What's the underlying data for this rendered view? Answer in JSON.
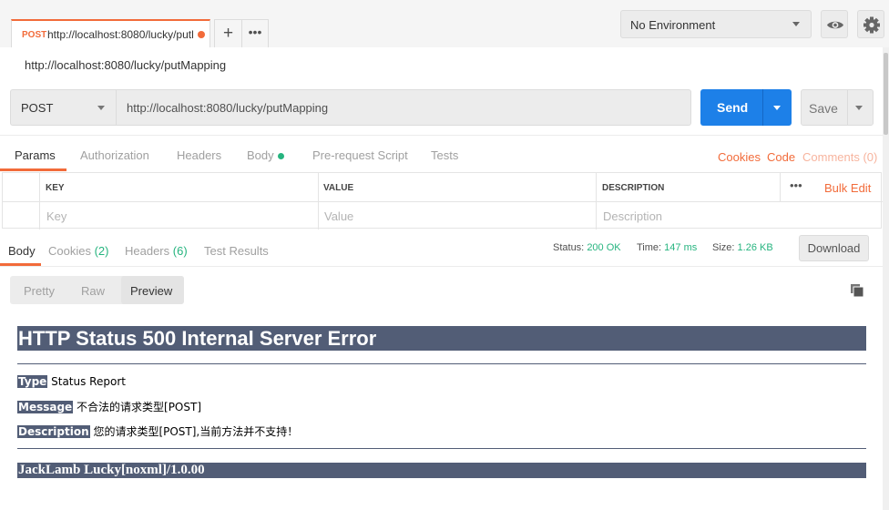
{
  "tab": {
    "method": "POST",
    "title": "http://localhost:8080/lucky/putl",
    "new_tab_label": "+",
    "more_label": "•••"
  },
  "environment": {
    "selected": "No Environment"
  },
  "request": {
    "name": "http://localhost:8080/lucky/putMapping",
    "method": "POST",
    "url": "http://localhost:8080/lucky/putMapping",
    "send_label": "Send",
    "save_label": "Save"
  },
  "request_tabs": [
    "Params",
    "Authorization",
    "Headers",
    "Body",
    "Pre-request Script",
    "Tests"
  ],
  "request_links": {
    "cookies": "Cookies",
    "code": "Code",
    "comments": "Comments (0)"
  },
  "params_table": {
    "headers": {
      "key": "KEY",
      "value": "VALUE",
      "description": "DESCRIPTION"
    },
    "more_label": "•••",
    "bulk_edit": "Bulk Edit",
    "placeholders": {
      "key": "Key",
      "value": "Value",
      "description": "Description"
    }
  },
  "response": {
    "tabs": {
      "body": "Body",
      "cookies": "Cookies",
      "cookies_count": "(2)",
      "headers": "Headers",
      "headers_count": "(6)",
      "test_results": "Test Results"
    },
    "status_label": "Status:",
    "status_value": "200 OK",
    "time_label": "Time:",
    "time_value": "147 ms",
    "size_label": "Size:",
    "size_value": "1.26 KB",
    "download_label": "Download",
    "views": [
      "Pretty",
      "Raw",
      "Preview"
    ]
  },
  "preview": {
    "heading": "HTTP Status 500 Internal Server Error",
    "type_label": "Type",
    "type_value": " Status Report",
    "message_label": "Message",
    "message_value": " 不合法的请求类型[POST]",
    "description_label": "Description",
    "description_value": " 您的请求类型[POST],当前方法并不支持！",
    "footer": "JackLamb Lucky[noxml]/1.0.00"
  },
  "colors": {
    "accent": "#f26b3a",
    "send_blue": "#1d80e8",
    "success_green": "#26b47f",
    "tomcat_header": "#525d76"
  },
  "icons": [
    "eye-icon",
    "gear-icon",
    "copy-icon",
    "chevron-down-icon"
  ]
}
